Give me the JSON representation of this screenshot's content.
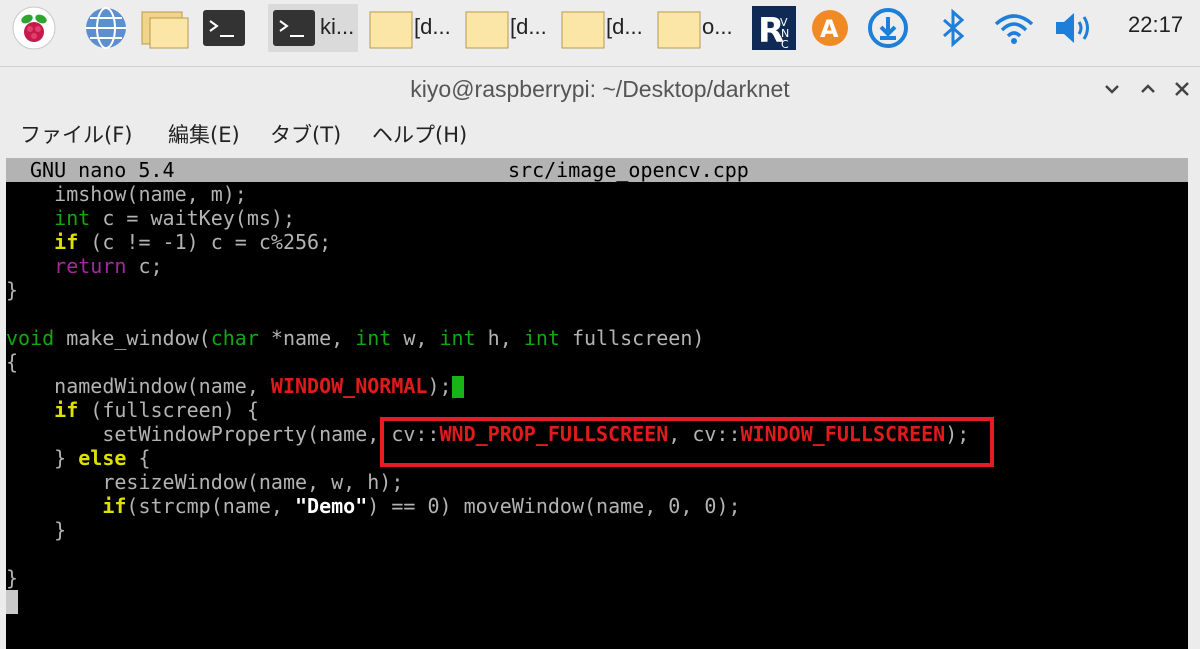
{
  "panel": {
    "icons": [
      "raspberry-menu-icon",
      "web-browser-icon",
      "file-manager-icon",
      "terminal-icon"
    ],
    "tasks": [
      {
        "name": "task-terminal",
        "label": "ki..."
      },
      {
        "name": "task-folder-1",
        "label": "[d..."
      },
      {
        "name": "task-folder-2",
        "label": "[d..."
      },
      {
        "name": "task-folder-3",
        "label": "[d..."
      },
      {
        "name": "task-folder-4",
        "label": "o..."
      }
    ],
    "tray": [
      "vnc-icon",
      "input-method-icon",
      "download-icon",
      "bluetooth-icon",
      "wifi-icon",
      "volume-icon"
    ],
    "clock": "22:17"
  },
  "window": {
    "title": "kiyo@raspberrypi: ~/Desktop/darknet",
    "menu": [
      "ファイル(F)",
      "編集(E)",
      "タブ(T)",
      "ヘルプ(H)"
    ]
  },
  "nano": {
    "version": "GNU nano 5.4",
    "filename": "src/image_opencv.cpp"
  },
  "code": {
    "l1": "    imshow(name, m);",
    "l2_kw": "int",
    "l2_rest": " c = waitKey(ms);",
    "l3_kw": "if",
    "l3_rest": " (c != -1) c = c%256;",
    "l4_kw": "return",
    "l4_rest": " c;",
    "l5": "}",
    "l7_void": "void",
    "l7_a": " make_window(",
    "l7_char": "char",
    "l7_b": " *name, ",
    "l7_int1": "int",
    "l7_c": " w, ",
    "l7_int2": "int",
    "l7_d": " h, ",
    "l7_int3": "int",
    "l7_e": " fullscreen)",
    "l8": "{",
    "l9_a": "    namedWindow(name, ",
    "l9_const": "WINDOW_NORMAL",
    "l9_b": ");",
    "l10_kw": "if",
    "l10_rest": " (fullscreen) {",
    "l11_a": "        setWindowProperty(name, cv::",
    "l11_c1": "WND_PROP_FULLSCREEN",
    "l11_b": ", cv::",
    "l11_c2": "WINDOW_FULLSCREEN",
    "l11_c": ");",
    "l12_a": "    } ",
    "l12_kw": "else",
    "l12_b": " {",
    "l13": "        resizeWindow(name, w, h);",
    "l14_kw": "if",
    "l14_a": "(strcmp(name, ",
    "l14_str": "\"Demo\"",
    "l14_b": ") == 0) moveWindow(name, 0, 0);",
    "l15": "    }",
    "l17": "}"
  },
  "colors": {
    "accent_highlight": "#e51c23",
    "cursor": "#17b317",
    "keyword_type": "#11a811",
    "keyword_control": "#e0e000",
    "keyword_return": "#a12aa1",
    "constant": "#e01b1b"
  }
}
